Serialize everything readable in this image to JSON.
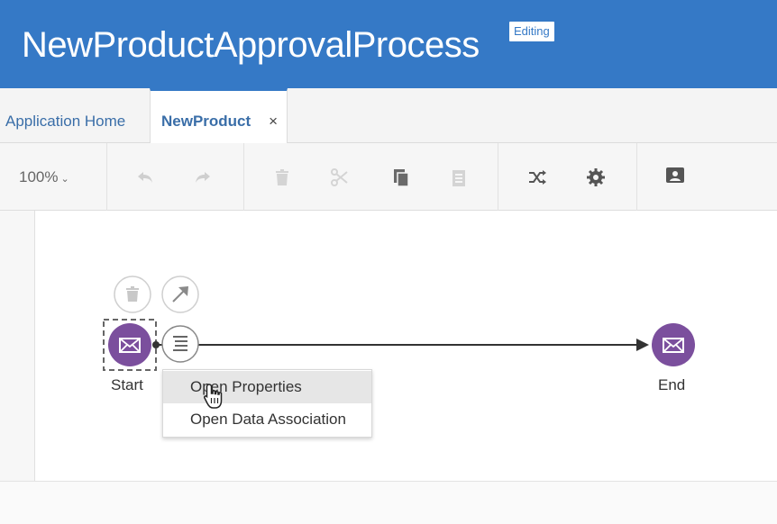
{
  "header": {
    "title": "NewProductApprovalProcess",
    "badge": "Editing",
    "bg_color": "#3579c6"
  },
  "tabs": [
    {
      "label": "Application Home",
      "active": false
    },
    {
      "label": "NewProduct",
      "active": true,
      "close_icon": "×"
    }
  ],
  "toolbar": {
    "zoom": "100%",
    "tools": [
      "undo-icon",
      "redo-icon",
      "delete-icon",
      "cut-icon",
      "copy-icon",
      "paste-icon",
      "shuffle-icon",
      "gear-icon",
      "user-card-icon"
    ]
  },
  "diagram": {
    "start_label": "Start",
    "end_label": "End",
    "node_color": "#7b4f9d",
    "node_icon": "envelope-icon",
    "start_actions": [
      "delete-icon",
      "connect-arrow-icon",
      "menu-list-icon"
    ]
  },
  "context_menu": {
    "items": [
      {
        "label": "Open Properties",
        "hover": true
      },
      {
        "label": "Open Data Association",
        "hover": false
      }
    ]
  }
}
